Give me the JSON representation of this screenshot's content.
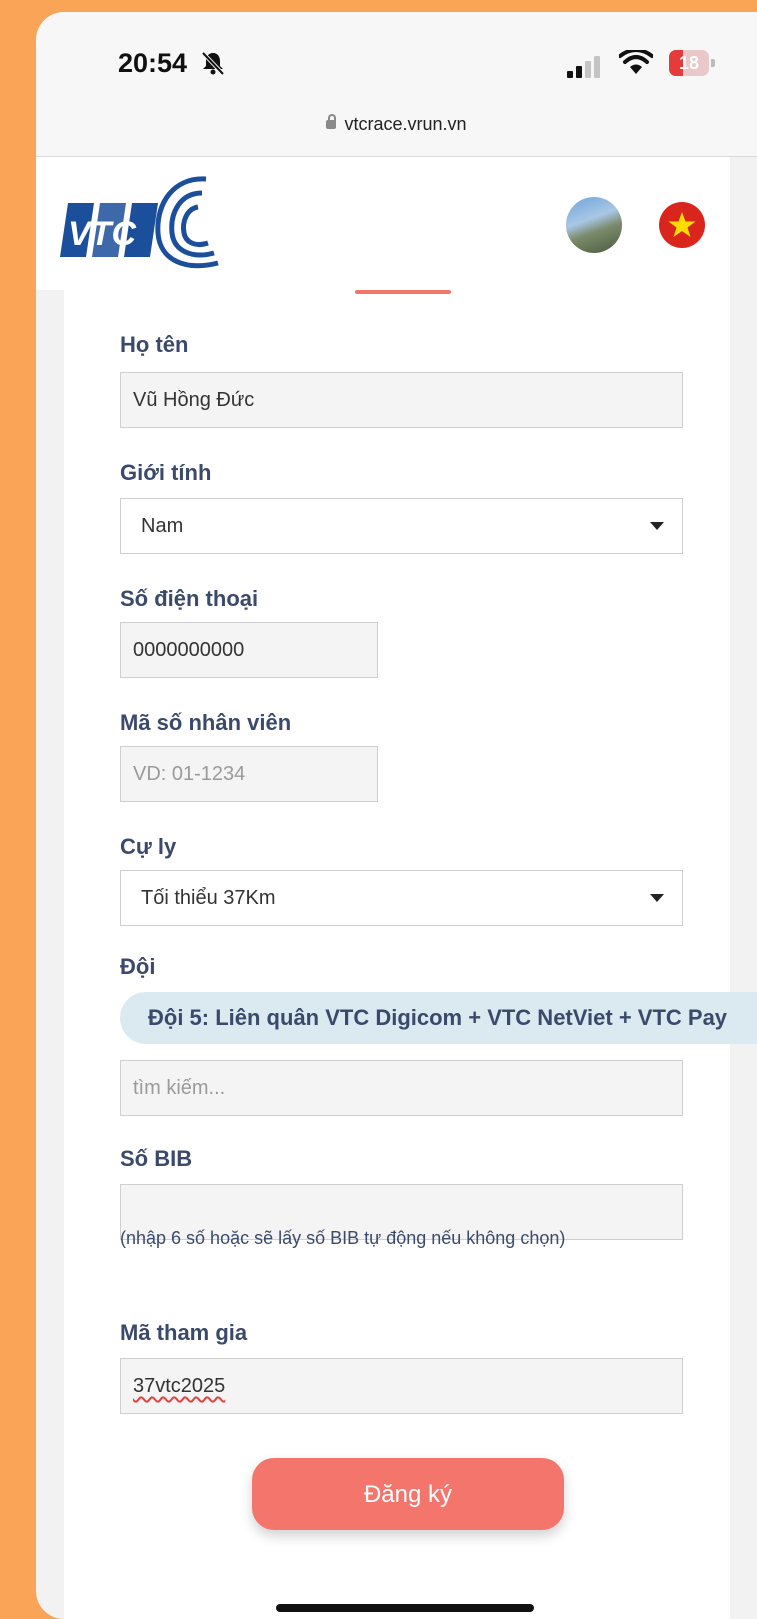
{
  "status": {
    "time": "20:54",
    "battery": "18"
  },
  "browser": {
    "url": "vtcrace.vrun.vn"
  },
  "header": {
    "logo_text": "VTC"
  },
  "form": {
    "name": {
      "label": "Họ tên",
      "value": "Vũ Hồng Đức"
    },
    "gender": {
      "label": "Giới tính",
      "value": "Nam"
    },
    "phone": {
      "label": "Số điện thoại",
      "value": "0000000000"
    },
    "employee_id": {
      "label": "Mã số nhân viên",
      "placeholder": "VD: 01-1234"
    },
    "distance": {
      "label": "Cự ly",
      "value": "Tối thiểu 37Km"
    },
    "team": {
      "label": "Đội",
      "selected": "Đội 5: Liên quân VTC Digicom + VTC NetViet + VTC Pay",
      "search_placeholder": "tìm kiếm..."
    },
    "bib": {
      "label": "Số BIB",
      "value": "",
      "hint": "(nhập 6 số hoặc sẽ lấy số BIB tự động nếu không chọn)"
    },
    "join_code": {
      "label": "Mã tham gia",
      "value": "37vtc2025"
    },
    "submit_label": "Đăng ký"
  },
  "colors": {
    "accent": "#f3756b",
    "label": "#3b4a6b",
    "background": "#f9a457",
    "chip": "#dbe9f1"
  }
}
